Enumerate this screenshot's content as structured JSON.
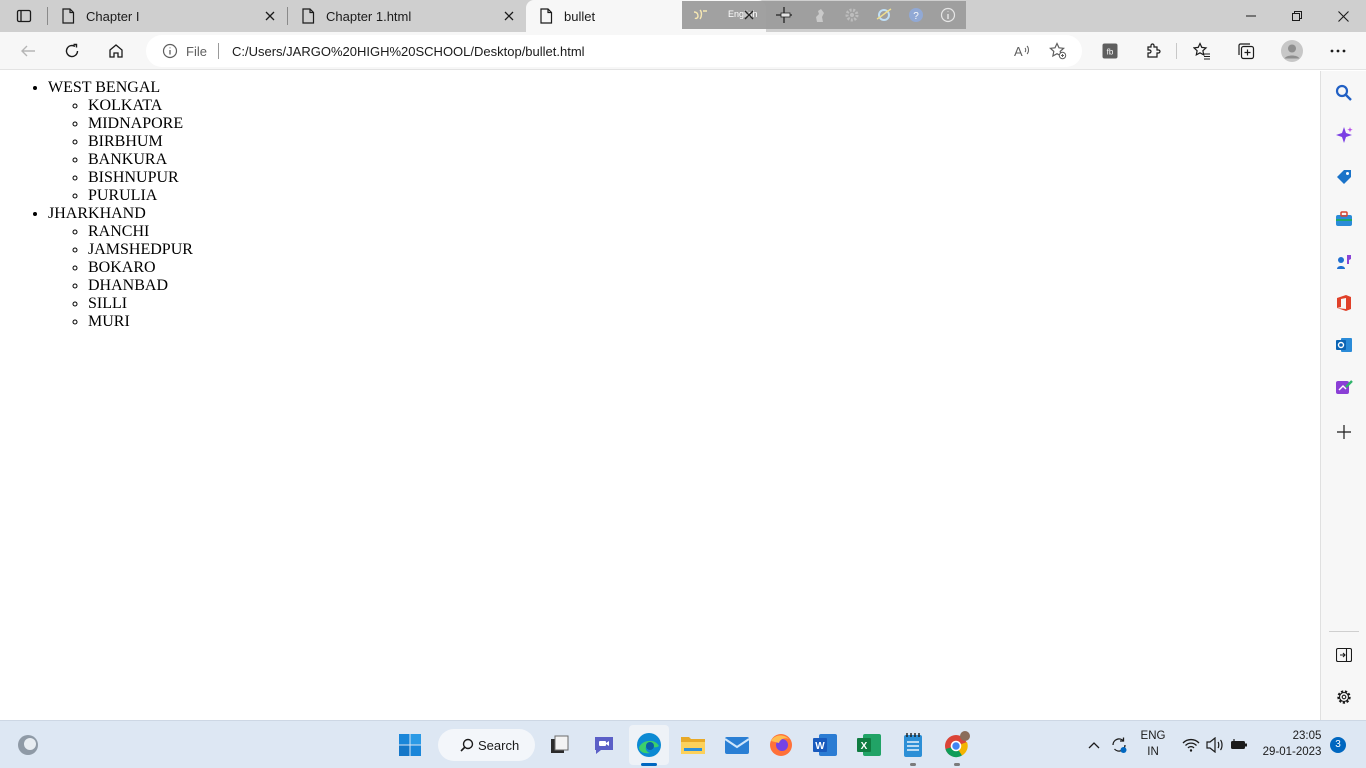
{
  "tabs": [
    {
      "title": "Chapter I"
    },
    {
      "title": "Chapter 1.html"
    },
    {
      "title": "bullet"
    }
  ],
  "overlay": {
    "language": "English"
  },
  "address": {
    "protocol": "File",
    "url": "C:/Users/JARGO%20HIGH%20SCHOOL/Desktop/bullet.html"
  },
  "page": {
    "groups": [
      {
        "state": "WEST BENGAL",
        "districts": [
          "KOLKATA",
          "MIDNAPORE",
          "BIRBHUM",
          "BANKURA",
          "BISHNUPUR",
          "PURULIA"
        ]
      },
      {
        "state": "JHARKHAND",
        "districts": [
          "RANCHI",
          "JAMSHEDPUR",
          "BOKARO",
          "DHANBAD",
          "SILLI",
          "MURI"
        ]
      }
    ]
  },
  "taskbar": {
    "search_label": "Search",
    "language": "ENG",
    "region": "IN",
    "time": "23:05",
    "date": "29-01-2023",
    "notifications": "3"
  },
  "colors": {
    "accent": "#0067c0",
    "tab_strip": "#cfcfcf",
    "toolbar": "#f7f7f7",
    "taskbar": "#dde7f3"
  },
  "icons": {
    "sidebar": [
      "search-icon",
      "copilot-icon",
      "shopping-icon",
      "tools-icon",
      "games-icon",
      "office-icon",
      "outlook-icon",
      "designer-icon",
      "add-icon",
      "split-screen-icon",
      "settings-icon"
    ],
    "taskbar": [
      "weather-icon",
      "start-icon",
      "task-view-icon",
      "teams-chat-icon",
      "edge-icon",
      "file-explorer-icon",
      "mail-icon",
      "firefox-icon",
      "word-icon",
      "excel-icon",
      "notepad-icon",
      "chrome-icon"
    ]
  }
}
